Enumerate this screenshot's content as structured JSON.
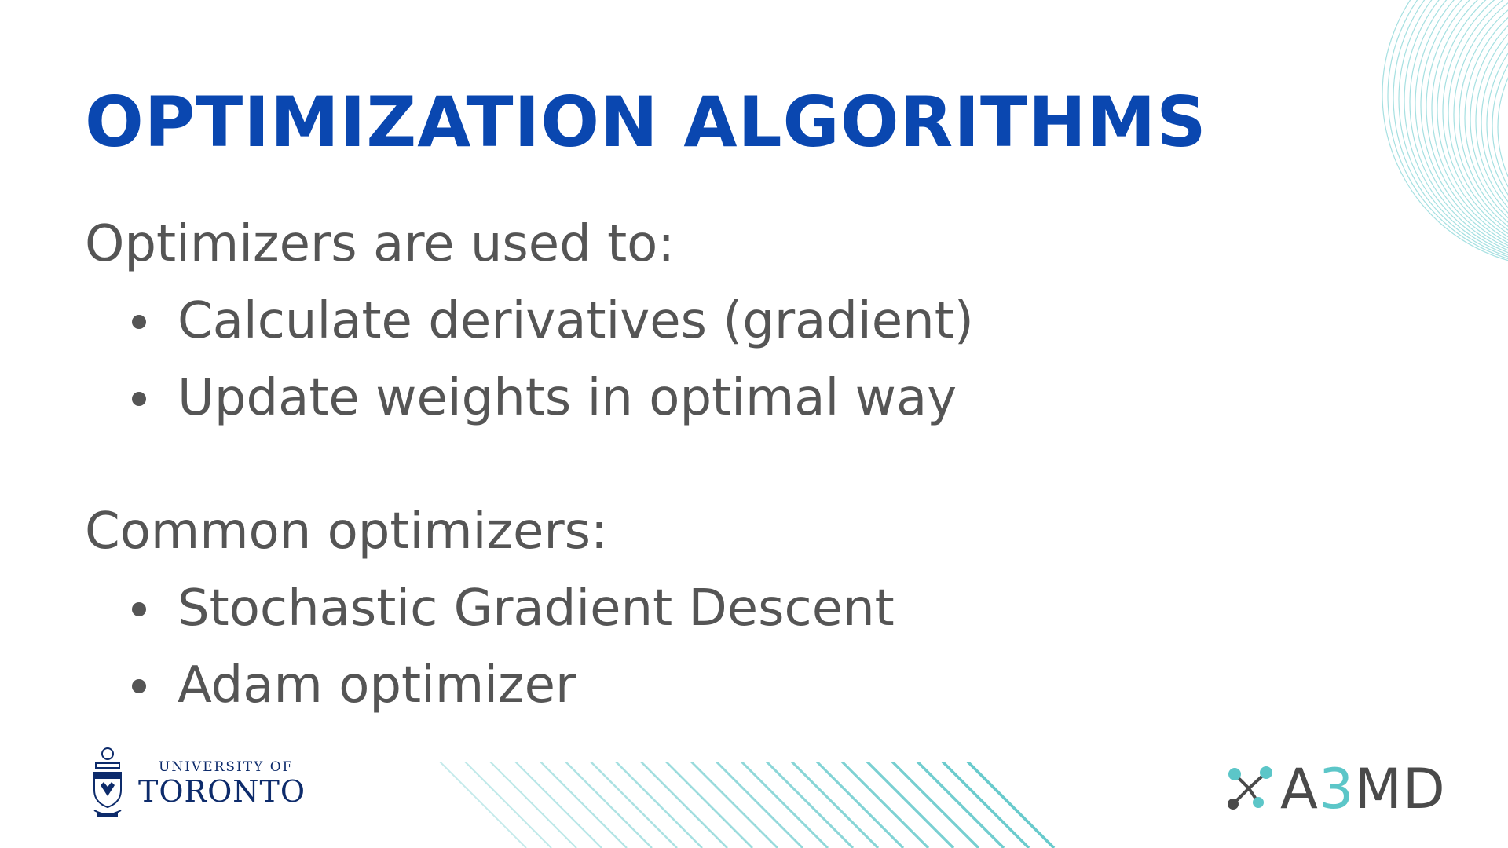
{
  "slide": {
    "title": "OPTIMIZATION ALGORITHMS",
    "sections": [
      {
        "heading": "Optimizers are used to:",
        "bullets": [
          "Calculate derivatives (gradient)",
          "Update weights in optimal way"
        ]
      },
      {
        "heading": "Common optimizers:",
        "bullets": [
          "Stochastic Gradient Descent",
          "Adam optimizer"
        ]
      }
    ]
  },
  "logos": {
    "uoft": {
      "line1": "UNIVERSITY OF",
      "line2": "TORONTO",
      "icon": "university-crest-icon"
    },
    "a3md": {
      "prefix": "A",
      "digit": "3",
      "suffix": "MD",
      "icon": "molecule-network-icon"
    }
  },
  "colors": {
    "title": "#0a47b0",
    "body_text": "#555555",
    "accent_teal": "#5cc6c8",
    "uoft_navy": "#0d2b6b",
    "a3md_gray": "#4a4a4a"
  }
}
